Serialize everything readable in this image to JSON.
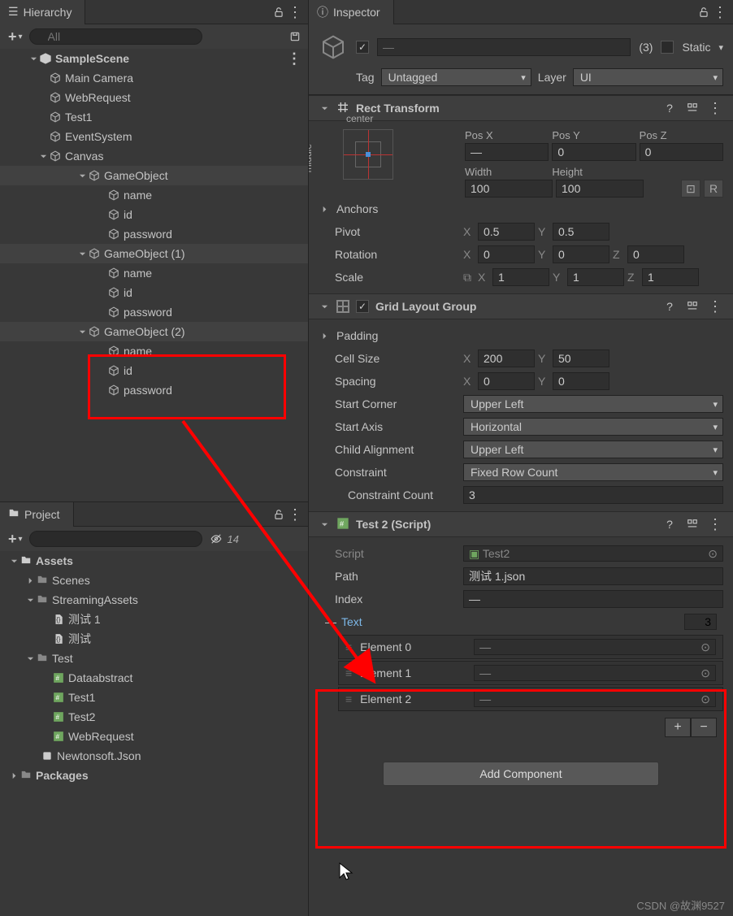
{
  "hierarchy": {
    "title": "Hierarchy",
    "search_placeholder": "All",
    "scene": "SampleScene",
    "items": {
      "main_camera": "Main Camera",
      "web_request": "WebRequest",
      "test1": "Test1",
      "event_system": "EventSystem",
      "canvas": "Canvas",
      "game_object": "GameObject",
      "game_object_1": "GameObject (1)",
      "game_object_2": "GameObject (2)",
      "name": "name",
      "id": "id",
      "password": "password"
    }
  },
  "project": {
    "title": "Project",
    "visibility_count": "14",
    "assets": "Assets",
    "scenes": "Scenes",
    "streaming_assets": "StreamingAssets",
    "test_folder": "Test",
    "packages": "Packages",
    "files": {
      "ceshi1": "测试 1",
      "ceshi": "测试",
      "dataabstract": "Dataabstract",
      "test1": "Test1",
      "test2": "Test2",
      "webrequest": "WebRequest",
      "newtonsoft": "Newtonsoft.Json"
    }
  },
  "inspector": {
    "title": "Inspector",
    "name_placeholder": "—",
    "multi_count": "(3)",
    "static_label": "Static",
    "tag_label": "Tag",
    "tag_value": "Untagged",
    "layer_label": "Layer",
    "layer_value": "UI",
    "rect_transform": {
      "title": "Rect Transform",
      "anchor_center": "center",
      "anchor_middle": "middle",
      "pos_x_label": "Pos X",
      "pos_x": "—",
      "pos_y_label": "Pos Y",
      "pos_y": "0",
      "pos_z_label": "Pos Z",
      "pos_z": "0",
      "width_label": "Width",
      "width": "100",
      "height_label": "Height",
      "height": "100",
      "anchors_label": "Anchors",
      "pivot_label": "Pivot",
      "pivot_x": "0.5",
      "pivot_y": "0.5",
      "rotation_label": "Rotation",
      "rot_x": "0",
      "rot_y": "0",
      "rot_z": "0",
      "scale_label": "Scale",
      "scale_x": "1",
      "scale_y": "1",
      "scale_z": "1"
    },
    "grid_layout": {
      "title": "Grid Layout Group",
      "padding_label": "Padding",
      "cell_size_label": "Cell Size",
      "cell_x": "200",
      "cell_y": "50",
      "spacing_label": "Spacing",
      "spacing_x": "0",
      "spacing_y": "0",
      "start_corner_label": "Start Corner",
      "start_corner": "Upper Left",
      "start_axis_label": "Start Axis",
      "start_axis": "Horizontal",
      "child_align_label": "Child Alignment",
      "child_align": "Upper Left",
      "constraint_label": "Constraint",
      "constraint": "Fixed Row Count",
      "constraint_count_label": "Constraint Count",
      "constraint_count": "3"
    },
    "test2_script": {
      "title": "Test 2 (Script)",
      "script_label": "Script",
      "script_value": "Test2",
      "path_label": "Path",
      "path_value": "测试 1.json",
      "index_label": "Index",
      "index_value": "—",
      "text_label": "Text",
      "text_count": "3",
      "elements": [
        "Element 0",
        "Element 1",
        "Element 2"
      ],
      "element_placeholder": "—"
    },
    "add_component": "Add Component"
  },
  "watermark": "CSDN @故渊9527"
}
